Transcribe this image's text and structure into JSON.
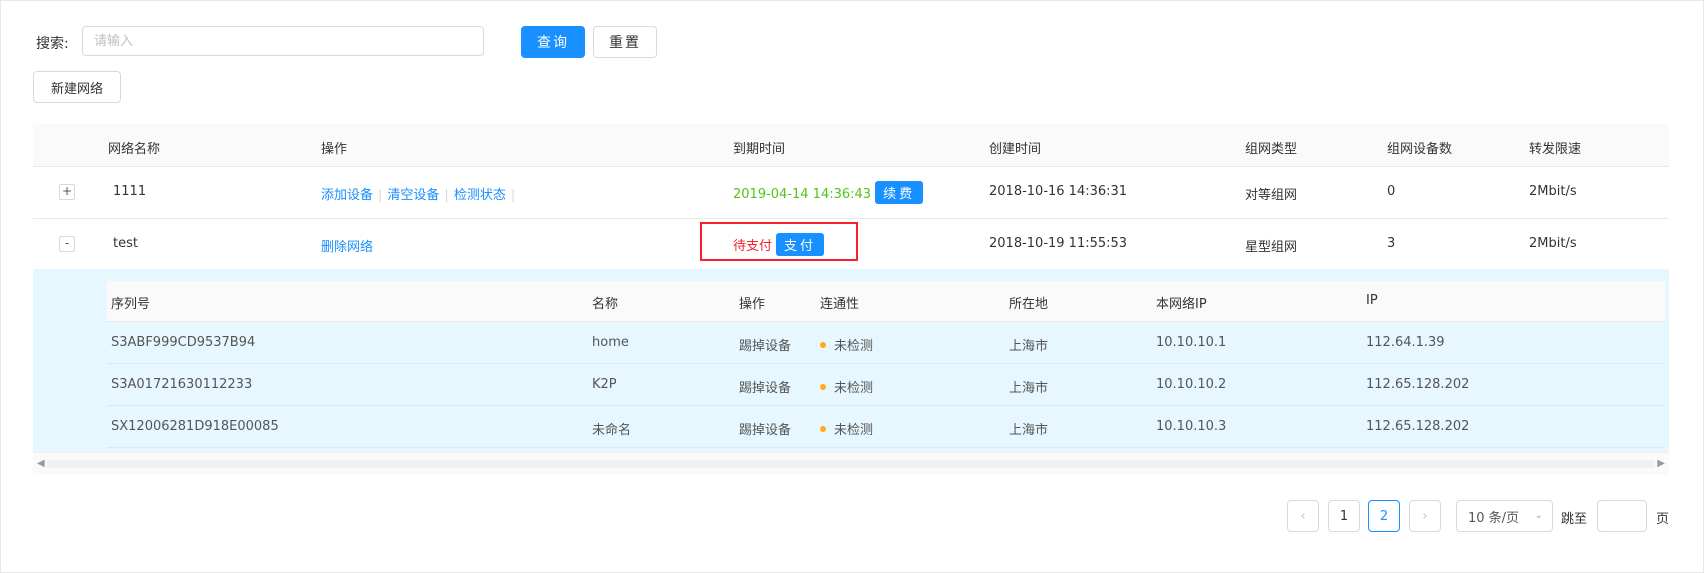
{
  "search": {
    "label": "搜索:",
    "placeholder": "请输入",
    "value": ""
  },
  "buttons": {
    "query": "查询",
    "reset": "重置",
    "new_network": "新建网络"
  },
  "table": {
    "headers": [
      "网络名称",
      "操作",
      "到期时间",
      "创建时间",
      "组网类型",
      "组网设备数",
      "转发限速"
    ],
    "rows": [
      {
        "expand": "+",
        "name": "1111",
        "actions": [
          "添加设备",
          "清空设备",
          "检测状态"
        ],
        "expiry": "2019-04-14 14:36:43",
        "expiry_button": "续费",
        "created": "2018-10-16 14:36:31",
        "type": "对等组网",
        "device_count": "0",
        "speed": "2Mbit/s"
      },
      {
        "expand": "-",
        "name": "test",
        "actions": [
          "删除网络"
        ],
        "expiry": "待支付",
        "expiry_button": "支付",
        "created": "2018-10-19 11:55:53",
        "type": "星型组网",
        "device_count": "3",
        "speed": "2Mbit/s"
      }
    ]
  },
  "devices": {
    "headers": [
      "序列号",
      "名称",
      "操作",
      "连通性",
      "所在地",
      "本网络IP",
      "IP"
    ],
    "rows": [
      {
        "serial": "S3ABF999CD9537B94",
        "name": "home",
        "action": "踢掉设备",
        "status": "未检测",
        "location": "上海市",
        "net_ip": "10.10.10.1",
        "ip": "112.64.1.39"
      },
      {
        "serial": "S3A01721630112233",
        "name": "K2P",
        "action": "踢掉设备",
        "status": "未检测",
        "location": "上海市",
        "net_ip": "10.10.10.2",
        "ip": "112.65.128.202"
      },
      {
        "serial": "SX12006281D918E00085",
        "name": "未命名",
        "action": "踢掉设备",
        "status": "未检测",
        "location": "上海市",
        "net_ip": "10.10.10.3",
        "ip": "112.65.128.202"
      }
    ]
  },
  "pagination": {
    "prev": "‹",
    "pages": [
      "1",
      "2"
    ],
    "current": "2",
    "next": "›",
    "page_size": "10 条/页",
    "jump_label": "跳至",
    "page_suffix": "页"
  },
  "colors": {
    "primary": "#1890ff",
    "expiry_ok": "#52c41a",
    "pending": "#f5222d",
    "status_dot": "#faad14",
    "expanded_bg": "#e6f7ff"
  }
}
